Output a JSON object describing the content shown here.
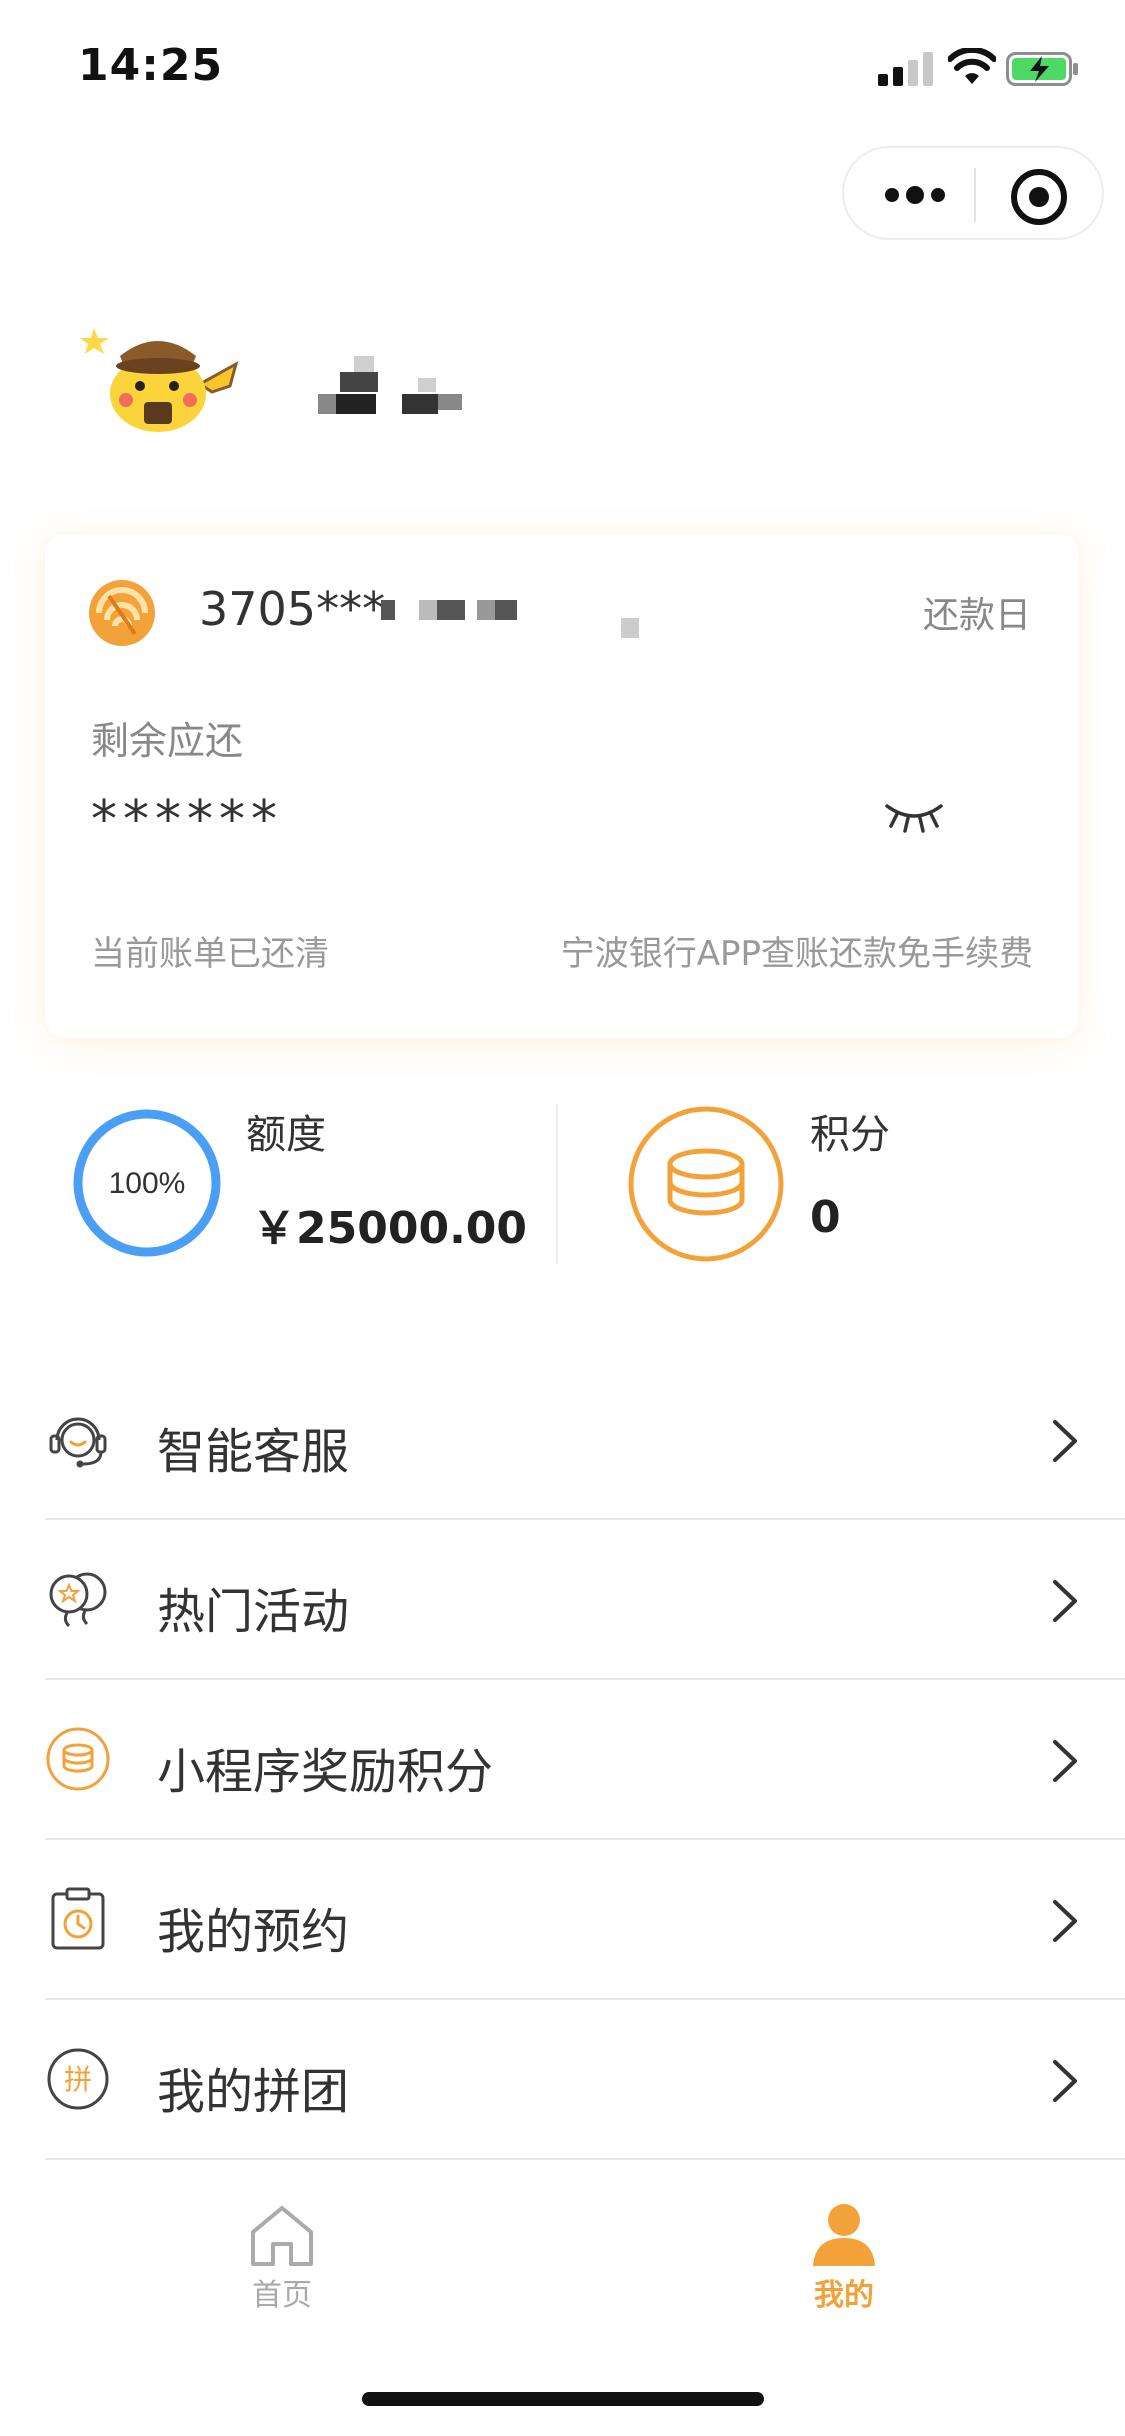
{
  "status_bar": {
    "time": "14:25"
  },
  "profile": {
    "avatar_icon": "pikachu-detective-avatar",
    "username_obscured": true
  },
  "account_card": {
    "card_number": "3705***",
    "due_day_label": "还款日",
    "remaining_label": "剩余应还",
    "amount_hidden": "******",
    "bill_status": "当前账单已还清",
    "promo": "宁波银行APP查账还款免手续费"
  },
  "stats": {
    "quota": {
      "progress_label": "100%",
      "progress_fraction": 1.0,
      "label": "额度",
      "value": "￥25000.00"
    },
    "points": {
      "label": "积分",
      "value": "0"
    }
  },
  "menu": {
    "items": [
      {
        "label": "智能客服",
        "icon": "customer-service-icon"
      },
      {
        "label": "热门活动",
        "icon": "balloon-icon"
      },
      {
        "label": "小程序奖励积分",
        "icon": "coin-stack-icon"
      },
      {
        "label": "我的预约",
        "icon": "clipboard-clock-icon"
      },
      {
        "label": "我的拼团",
        "icon": "group-buy-icon"
      }
    ],
    "group_buy_glyph": "拼"
  },
  "tabbar": {
    "tabs": [
      {
        "label": "首页",
        "icon": "home-icon",
        "active": false
      },
      {
        "label": "我的",
        "icon": "user-icon",
        "active": true
      }
    ]
  },
  "colors": {
    "accent": "#f3a23a",
    "quota_ring": "#4a9ff5",
    "text_primary": "#333333",
    "text_secondary": "#999999"
  }
}
